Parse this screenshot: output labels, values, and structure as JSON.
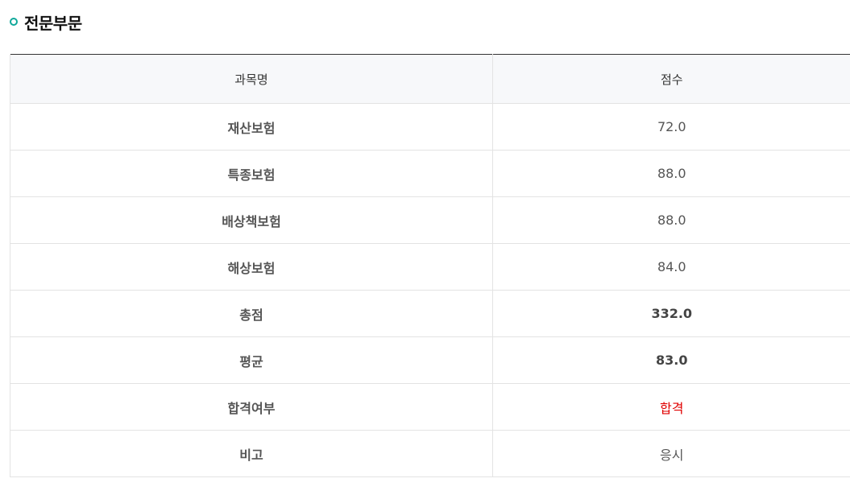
{
  "section": {
    "title": "전문부문"
  },
  "table": {
    "headers": {
      "subject": "과목명",
      "score": "점수"
    },
    "rows": [
      {
        "subject": "재산보험",
        "score": "72.0"
      },
      {
        "subject": "특종보험",
        "score": "88.0"
      },
      {
        "subject": "배상책보험",
        "score": "88.0"
      },
      {
        "subject": "해상보험",
        "score": "84.0"
      },
      {
        "subject": "총점",
        "score": "332.0"
      },
      {
        "subject": "평균",
        "score": "83.0"
      },
      {
        "subject": "합격여부",
        "score": "합격"
      },
      {
        "subject": "비고",
        "score": "응시"
      }
    ]
  },
  "colors": {
    "accent": "#10a89a",
    "pass": "#e00000"
  }
}
